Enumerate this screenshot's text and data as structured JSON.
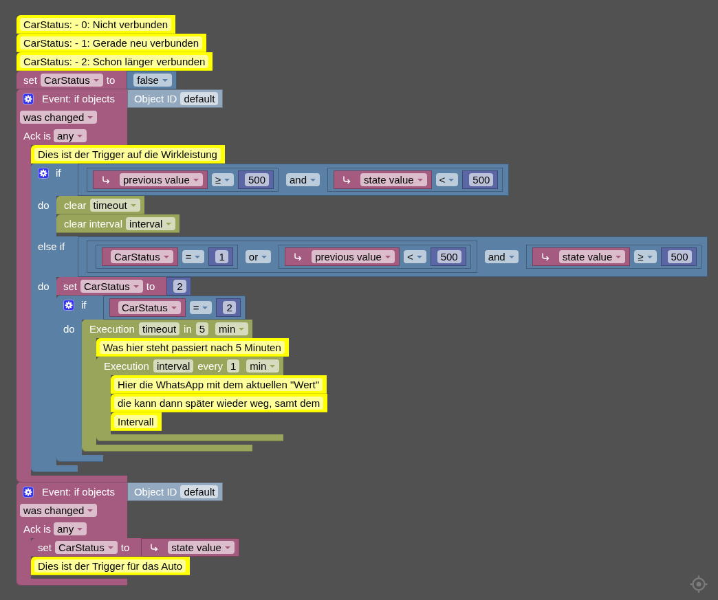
{
  "workspace": {
    "blocks": [
      {
        "kind": "comment",
        "text": "CarStatus: - 0: Nicht verbunden"
      },
      {
        "kind": "comment",
        "text": "CarStatus: - 1: Gerade neu verbunden"
      },
      {
        "kind": "comment",
        "text": "CarStatus: - 2: Schon länger verbunden"
      },
      {
        "kind": "set",
        "label": "set",
        "variable": "CarStatus",
        "connector": "to",
        "value": {
          "kind": "boolean",
          "value": "false"
        }
      },
      {
        "kind": "event",
        "title": "Event: if objects",
        "object": {
          "kind": "object_id",
          "label": "Object ID",
          "value": "default"
        },
        "trigger": "was changed",
        "ack_label": "Ack is",
        "ack": "any",
        "statements": [
          {
            "kind": "comment",
            "text": "Dies ist der Trigger auf die Wirkleistung"
          },
          {
            "kind": "if",
            "branches": [
              {
                "label": "if",
                "condition": {
                  "kind": "logic",
                  "left": {
                    "kind": "compare",
                    "left": {
                      "kind": "trigger_info",
                      "attribute": "previous value"
                    },
                    "operator": "≥",
                    "right": {
                      "kind": "number",
                      "value": "500"
                    }
                  },
                  "operator": "and",
                  "right": {
                    "kind": "compare",
                    "left": {
                      "kind": "trigger_info",
                      "attribute": "state value"
                    },
                    "operator": "<",
                    "right": {
                      "kind": "number",
                      "value": "500"
                    }
                  }
                },
                "do_label": "do",
                "statements": [
                  {
                    "kind": "clear",
                    "label": "clear",
                    "target": "timeout"
                  },
                  {
                    "kind": "clear",
                    "label": "clear interval",
                    "target": "interval"
                  }
                ]
              },
              {
                "label": "else if",
                "condition": {
                  "kind": "logic",
                  "left": {
                    "kind": "logic",
                    "left": {
                      "kind": "compare",
                      "left": {
                        "kind": "variable",
                        "name": "CarStatus"
                      },
                      "operator": "=",
                      "right": {
                        "kind": "number",
                        "value": "1"
                      }
                    },
                    "operator": "or",
                    "right": {
                      "kind": "compare",
                      "left": {
                        "kind": "trigger_info",
                        "attribute": "previous value"
                      },
                      "operator": "<",
                      "right": {
                        "kind": "number",
                        "value": "500"
                      }
                    }
                  },
                  "operator": "and",
                  "right": {
                    "kind": "compare",
                    "left": {
                      "kind": "trigger_info",
                      "attribute": "state value"
                    },
                    "operator": "≥",
                    "right": {
                      "kind": "number",
                      "value": "500"
                    }
                  }
                },
                "do_label": "do",
                "statements": [
                  {
                    "kind": "set",
                    "label": "set",
                    "variable": "CarStatus",
                    "connector": "to",
                    "value": {
                      "kind": "number",
                      "value": "2"
                    }
                  },
                  {
                    "kind": "if",
                    "branches": [
                      {
                        "label": "if",
                        "condition": {
                          "kind": "compare",
                          "left": {
                            "kind": "variable",
                            "name": "CarStatus"
                          },
                          "operator": "=",
                          "right": {
                            "kind": "number",
                            "value": "2"
                          }
                        },
                        "do_label": "do",
                        "statements": [
                          {
                            "kind": "timeout",
                            "label": "Execution",
                            "name": "timeout",
                            "connector": "in",
                            "delay": "5",
                            "unit": "min",
                            "statements": [
                              {
                                "kind": "comment",
                                "text": "Was hier steht passiert nach 5 Minuten"
                              },
                              {
                                "kind": "interval",
                                "label": "Execution",
                                "name": "interval",
                                "connector": "every",
                                "delay": "1",
                                "unit": "min",
                                "statements": [
                                  {
                                    "kind": "comment",
                                    "text": "Hier die WhatsApp mit dem aktuellen \"Wert\""
                                  },
                                  {
                                    "kind": "comment",
                                    "text": "die kann dann später wieder weg, samt dem"
                                  },
                                  {
                                    "kind": "comment",
                                    "text": "Intervall"
                                  }
                                ]
                              }
                            ]
                          }
                        ]
                      }
                    ]
                  }
                ]
              }
            ]
          }
        ]
      },
      {
        "kind": "event",
        "title": "Event: if objects",
        "object": {
          "kind": "object_id",
          "label": "Object ID",
          "value": "default"
        },
        "trigger": "was changed",
        "ack_label": "Ack is",
        "ack": "any",
        "statements": [
          {
            "kind": "set",
            "label": "set",
            "variable": "CarStatus",
            "connector": "to",
            "value": {
              "kind": "trigger_info",
              "attribute": "state value"
            }
          },
          {
            "kind": "comment",
            "text": "Dies ist der Trigger für das Auto"
          }
        ]
      }
    ]
  }
}
